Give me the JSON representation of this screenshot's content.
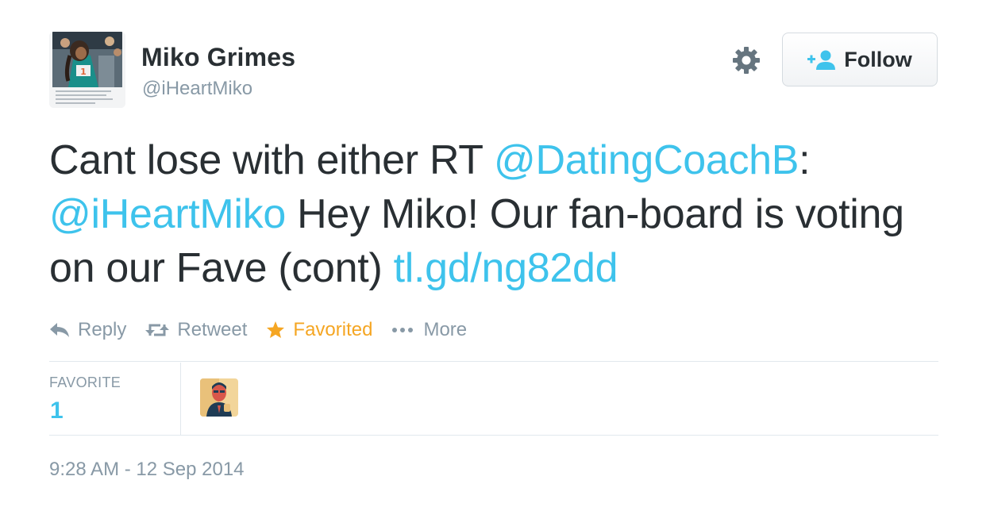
{
  "author": {
    "name": "Miko Grimes",
    "handle": "@iHeartMiko",
    "avatar_icon": "profile-photo"
  },
  "header": {
    "settings_icon": "gear-icon",
    "follow_label": "Follow",
    "follow_icon": "add-user-icon"
  },
  "tweet": {
    "part1": "Cant lose with either RT ",
    "mention1": "@DatingCoachB",
    "part2": ": ",
    "mention2": "@iHeartMiko",
    "part3": " Hey Miko! Our fan-board is voting on our Fave (cont) ",
    "link": "tl.gd/ng82dd"
  },
  "actions": {
    "reply": "Reply",
    "retweet": "Retweet",
    "favorited": "Favorited",
    "more": "More"
  },
  "stats": {
    "label": "FAVORITE",
    "count": "1"
  },
  "timestamp": "9:28 AM - 12 Sep 2014",
  "colors": {
    "link": "#3ec3ec",
    "favorited": "#f5a623",
    "muted": "#8899a6",
    "text": "#292f33"
  }
}
